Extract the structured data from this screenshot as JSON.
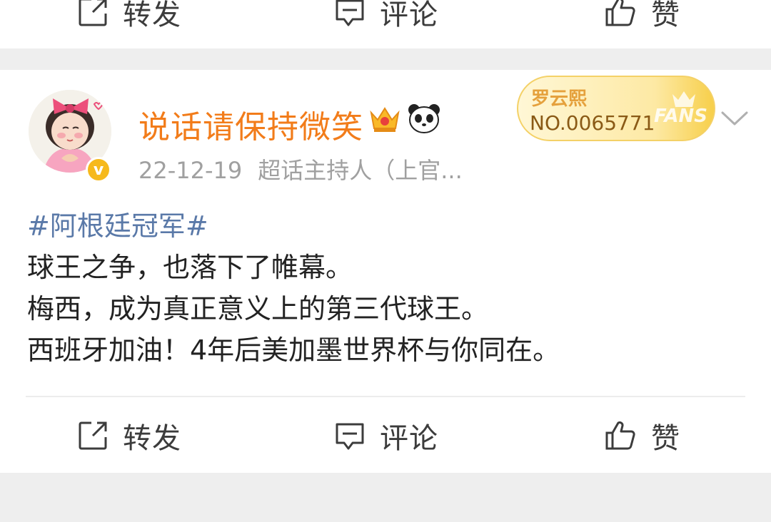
{
  "top_actions": {
    "repost_label": "转发",
    "comment_label": "评论",
    "like_label": "赞"
  },
  "post": {
    "username": "说话请保持微笑",
    "verified_badge": "v",
    "date": "22-12-19",
    "source": "超话主持人（上官...",
    "fans_card": {
      "name": "罗云熙",
      "number": "NO.0065771",
      "mark": "FANS"
    },
    "hashtag": "#阿根廷冠军#",
    "lines": [
      "球王之争，也落下了帷幕。",
      "梅西，成为真正意义上的第三代球王。",
      "西班牙加油！4年后美加墨世界杯与你同在。"
    ],
    "actions": {
      "repost_label": "转发",
      "comment_label": "评论",
      "like_label": "赞"
    }
  },
  "colors": {
    "username": "#f27c1a",
    "hashtag": "#5a79a8",
    "background": "#eeeeee",
    "card": "#ffffff"
  },
  "icons": [
    "repost-icon",
    "comment-icon",
    "like-icon",
    "crown-icon",
    "panda-icon",
    "chevron-down-icon"
  ]
}
